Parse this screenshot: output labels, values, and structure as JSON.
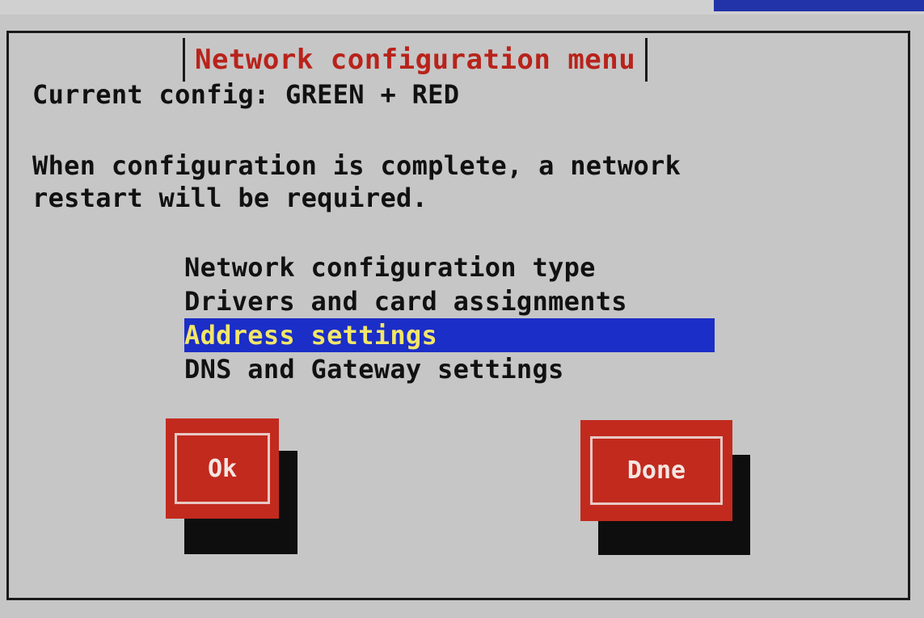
{
  "dialog": {
    "title": "Network configuration menu",
    "current_config": "Current config: GREEN + RED",
    "notice_line1": "When configuration is complete, a network",
    "notice_line2": "restart will be required."
  },
  "menu": {
    "items": [
      {
        "label": "Network configuration type",
        "selected": false
      },
      {
        "label": "Drivers and card assignments",
        "selected": false
      },
      {
        "label": "Address settings",
        "selected": true
      },
      {
        "label": "DNS and Gateway settings",
        "selected": false
      }
    ]
  },
  "buttons": {
    "ok_label": "Ok",
    "done_label": "Done"
  },
  "colors": {
    "title": "#b8231b",
    "button": "#c22a1e",
    "selection_bg": "#1b2ec7",
    "selection_fg": "#f2e66a",
    "background": "#c6c6c6"
  }
}
